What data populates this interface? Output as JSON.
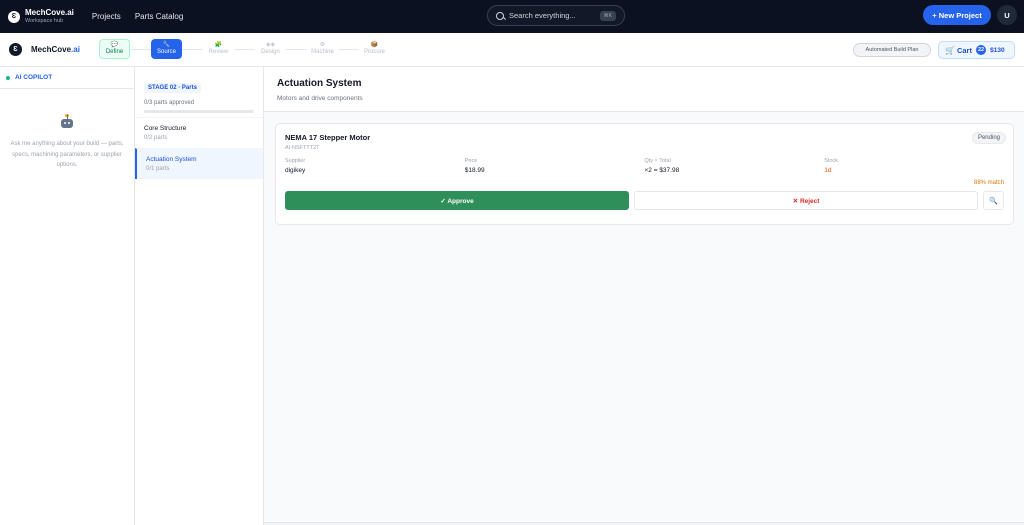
{
  "topbar": {
    "brand_name": "MechCove.ai",
    "brand_sub": "Workspace hub",
    "logo_glyph": "Ɛ",
    "nav": [
      "Projects",
      "Parts Catalog"
    ],
    "search_placeholder": "Search everything...",
    "search_kbd": "⌘K",
    "new_project_label": "+ New Project",
    "avatar_initial": "U"
  },
  "stagebar": {
    "brand_prefix": "MechCove",
    "brand_suffix": ".ai",
    "stages": [
      {
        "label": "Define",
        "icon": "💬",
        "state": "done"
      },
      {
        "label": "Source",
        "icon": "🔧",
        "state": "active"
      },
      {
        "label": "Review",
        "icon": "🧩",
        "state": "future"
      },
      {
        "label": "Design",
        "icon": "◈◈",
        "state": "future"
      },
      {
        "label": "Machine",
        "icon": "⚙",
        "state": "future"
      },
      {
        "label": "Procure",
        "icon": "📦",
        "state": "future"
      }
    ],
    "automated_plan_label": "Automated Build Plan",
    "cart_label": "Cart",
    "cart_count": "22",
    "cart_total": "$130"
  },
  "copilot": {
    "title": "AI COPILOT",
    "hint": "Ask me anything about your build — parts, specs, machining parameters, or supplier options."
  },
  "partsnav": {
    "stage_badge": "STAGE 02 · Parts",
    "approved_text": "0/3 parts approved",
    "progress_fraction": 0,
    "items": [
      {
        "title": "Core Structure",
        "sub": "0/2 parts",
        "active": false
      },
      {
        "title": "Actuation System",
        "sub": "0/1 parts",
        "active": true
      }
    ]
  },
  "main": {
    "title": "Actuation System",
    "subtitle": "Motors and drive components",
    "card": {
      "part_name": "NEMA 17 Stepper Motor",
      "part_id": "AI-NSFTTT2T",
      "status": "Pending",
      "specs": [
        {
          "label": "Supplier",
          "value": "digikey"
        },
        {
          "label": "Price",
          "value": "$18.99"
        },
        {
          "label": "Qty × Total",
          "value": "×2 = $37.98"
        },
        {
          "label": "Stock",
          "value": "1d"
        }
      ],
      "match": "88% match",
      "approve_label": "✓ Approve",
      "reject_label": "✕ Reject",
      "inspect_icon": "🔍"
    }
  },
  "colors": {
    "accent": "#2563eb",
    "topbar_bg": "#0b1120",
    "approve": "#2f8f5b",
    "reject": "#dc2626",
    "match": "#d97706"
  }
}
